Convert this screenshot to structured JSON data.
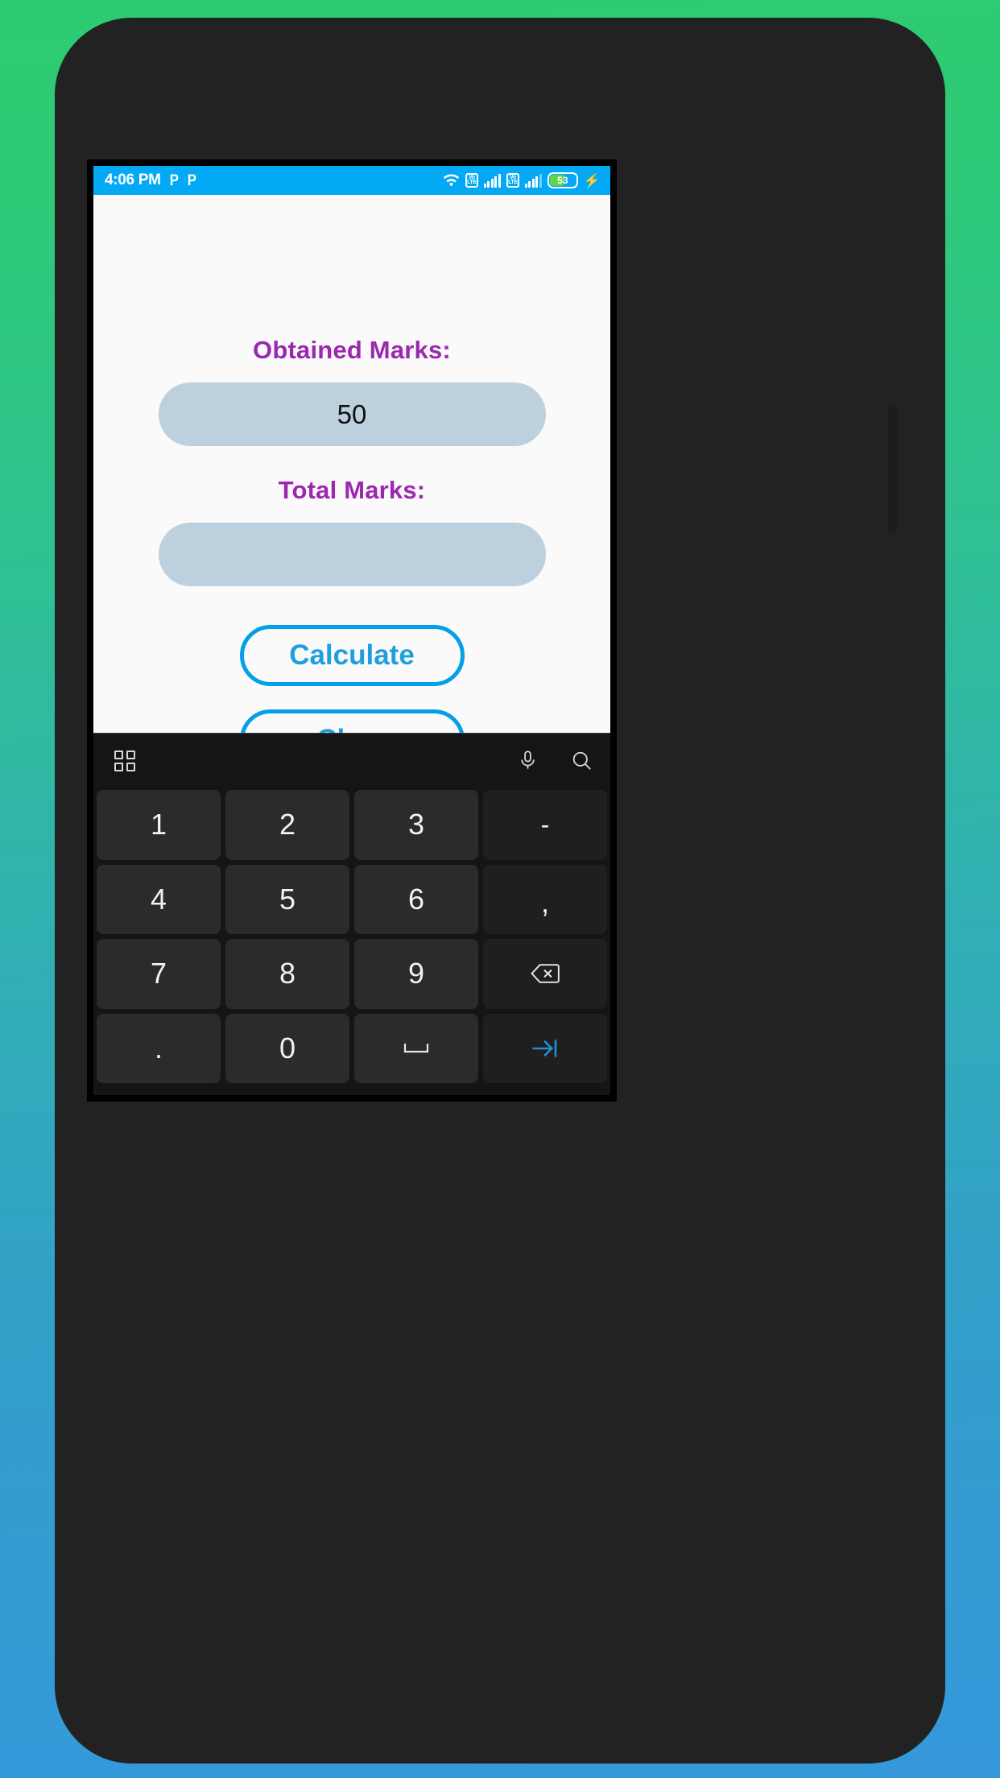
{
  "status_bar": {
    "time": "4:06 PM",
    "app_icon_1": "P",
    "app_icon_2": "P",
    "wifi_icon": "wifi-icon",
    "volte_label_top": "Vo",
    "volte_label_bottom": "LTE",
    "battery_percent": "53",
    "charging_icon": "⚡",
    "bg_color": "#03a9f4"
  },
  "app": {
    "obtained_marks_label": "Obtained Marks:",
    "obtained_marks_value": "50",
    "obtained_marks_placeholder": "",
    "total_marks_label": "Total Marks:",
    "total_marks_value": "",
    "total_marks_placeholder": "",
    "calculate_label": "Calculate",
    "clear_label": "Clear",
    "label_color": "#9c27b0",
    "button_color": "#03a0e9",
    "input_bg_color": "#bdd0de",
    "page_bg_color": "#fafafa"
  },
  "keyboard": {
    "toolbar": {
      "grid_icon": "grid-icon",
      "mic_icon": "microphone-icon",
      "search_icon": "search-icon"
    },
    "rows": [
      [
        {
          "label": "1",
          "name": "key-1",
          "type": "digit"
        },
        {
          "label": "2",
          "name": "key-2",
          "type": "digit"
        },
        {
          "label": "3",
          "name": "key-3",
          "type": "digit"
        },
        {
          "label": "-",
          "name": "key-minus",
          "type": "minus"
        }
      ],
      [
        {
          "label": "4",
          "name": "key-4",
          "type": "digit"
        },
        {
          "label": "5",
          "name": "key-5",
          "type": "digit"
        },
        {
          "label": "6",
          "name": "key-6",
          "type": "digit"
        },
        {
          "label": ",",
          "name": "key-comma",
          "type": "comma"
        }
      ],
      [
        {
          "label": "7",
          "name": "key-7",
          "type": "digit"
        },
        {
          "label": "8",
          "name": "key-8",
          "type": "digit"
        },
        {
          "label": "9",
          "name": "key-9",
          "type": "digit"
        },
        {
          "label": "",
          "name": "key-backspace",
          "type": "backspace"
        }
      ],
      [
        {
          "label": ".",
          "name": "key-dot",
          "type": "dot"
        },
        {
          "label": "0",
          "name": "key-0",
          "type": "digit"
        },
        {
          "label": "",
          "name": "key-space",
          "type": "space"
        },
        {
          "label": "",
          "name": "key-next",
          "type": "tab"
        }
      ]
    ],
    "bg_color": "#151515",
    "key_color": "#2b2b2b",
    "accent_color": "#1e8fd0"
  },
  "background": {
    "gradient_top": "#2ecc71",
    "gradient_bottom": "#3498db"
  }
}
